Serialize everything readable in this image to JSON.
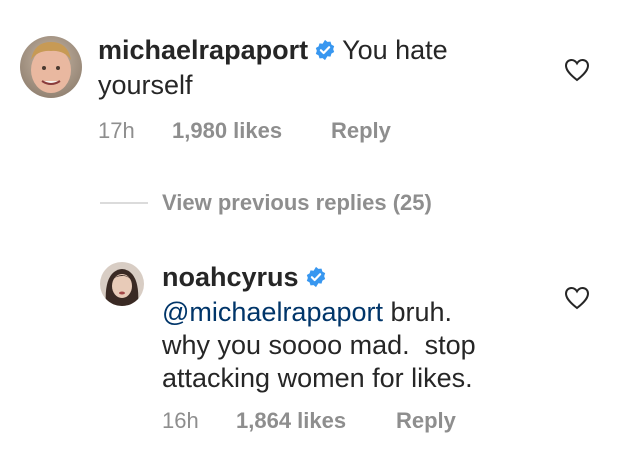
{
  "comments": [
    {
      "username": "michaelrapaport",
      "text_line1": "You hate",
      "text_line2": "yourself",
      "time": "17h",
      "likes": "1,980 likes",
      "reply_label": "Reply"
    },
    {
      "username": "noahcyrus",
      "mention": "@michaelrapaport",
      "text_line1_rest": " bruh.",
      "text_line2": "why you soooo mad.  stop",
      "text_line3": "attacking women for likes.",
      "time": "16h",
      "likes": "1,864 likes",
      "reply_label": "Reply"
    }
  ],
  "view_previous_replies": "View previous replies (25)",
  "colors": {
    "text": "#262626",
    "muted": "#8e8e8e",
    "mention": "#003569",
    "verified": "#3897f0"
  },
  "icons": [
    "verified-badge-icon",
    "heart-icon"
  ]
}
